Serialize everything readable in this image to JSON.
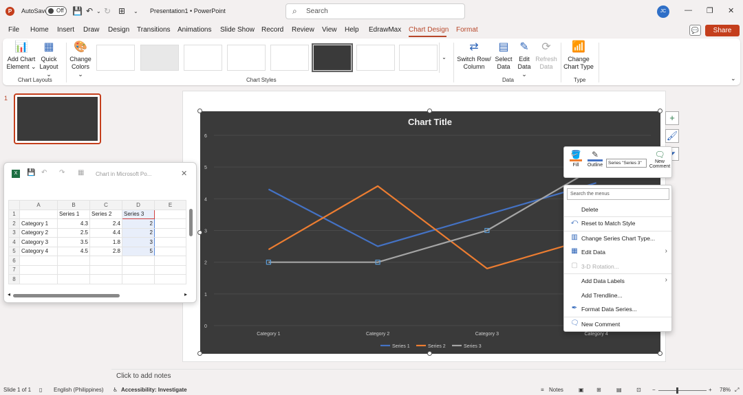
{
  "titlebar": {
    "logo": "P",
    "autosave_label": "AutoSave",
    "autosave_state": "Off",
    "doc_title": "Presentation1 • PowerPoint",
    "search_placeholder": "Search",
    "avatar_initials": "JC"
  },
  "menu": {
    "tabs": [
      "File",
      "Home",
      "Insert",
      "Draw",
      "Design",
      "Transitions",
      "Animations",
      "Slide Show",
      "Record",
      "Review",
      "View",
      "Help",
      "EdrawMax",
      "Chart Design",
      "Format"
    ],
    "active": "Chart Design",
    "share_label": "Share"
  },
  "ribbon": {
    "add_chart_element": [
      "Add Chart",
      "Element"
    ],
    "quick_layout": [
      "Quick",
      "Layout"
    ],
    "change_colors": [
      "Change",
      "Colors"
    ],
    "switch_row_column": [
      "Switch Row/",
      "Column"
    ],
    "select_data": [
      "Select",
      "Data"
    ],
    "edit_data": [
      "Edit",
      "Data"
    ],
    "refresh_data": [
      "Refresh",
      "Data"
    ],
    "change_chart_type": [
      "Change",
      "Chart Type"
    ],
    "groups": {
      "chart_layouts": "Chart Layouts",
      "chart_styles": "Chart Styles",
      "data": "Data",
      "type": "Type"
    }
  },
  "slides_panel": {
    "slide_number": "1"
  },
  "excel": {
    "title": "Chart in Microsoft Po...",
    "columns": [
      "A",
      "B",
      "C",
      "D",
      "E"
    ],
    "rows": [
      [
        "",
        "Series 1",
        "Series 2",
        "Series 3",
        ""
      ],
      [
        "Category 1",
        "4.3",
        "2.4",
        "2",
        ""
      ],
      [
        "Category 2",
        "2.5",
        "4.4",
        "2",
        ""
      ],
      [
        "Category 3",
        "3.5",
        "1.8",
        "3",
        ""
      ],
      [
        "Category 4",
        "4.5",
        "2.8",
        "5",
        ""
      ],
      [
        "",
        "",
        "",
        "",
        ""
      ],
      [
        "",
        "",
        "",
        "",
        ""
      ],
      [
        "",
        "",
        "",
        "",
        ""
      ]
    ],
    "row_numbers": [
      "1",
      "2",
      "3",
      "4",
      "5",
      "6",
      "7",
      "8"
    ]
  },
  "chart_data": {
    "type": "line",
    "title": "Chart Title",
    "categories": [
      "Category 1",
      "Category 2",
      "Category 3",
      "Category 4"
    ],
    "series": [
      {
        "name": "Series 1",
        "values": [
          4.3,
          2.5,
          3.5,
          4.5
        ],
        "color": "#4472c4"
      },
      {
        "name": "Series 2",
        "values": [
          2.4,
          4.4,
          1.8,
          2.8
        ],
        "color": "#ed7d31"
      },
      {
        "name": "Series 3",
        "values": [
          2,
          2,
          3,
          5
        ],
        "color": "#a5a5a5"
      }
    ],
    "ylim": [
      0,
      6
    ],
    "yticks": [
      "0",
      "1",
      "2",
      "3",
      "4",
      "5",
      "6"
    ],
    "legend_position": "bottom",
    "background": "#3a3a3a"
  },
  "mini_toolbar": {
    "fill_label": "Fill",
    "outline_label": "Outline",
    "series_select": "Series \"Series 3\"",
    "new_comment_label": [
      "New",
      "Comment"
    ]
  },
  "context_menu": {
    "search_placeholder": "Search the menus",
    "items": [
      {
        "label": "Delete",
        "icon": "",
        "disabled": false,
        "submenu": false
      },
      {
        "label": "Reset to Match Style",
        "icon": "reset-style-icon",
        "disabled": false,
        "submenu": false
      },
      {
        "label": "Change Series Chart Type...",
        "icon": "chart-type-icon",
        "disabled": false,
        "submenu": false
      },
      {
        "label": "Edit Data",
        "icon": "edit-data-icon",
        "disabled": false,
        "submenu": true
      },
      {
        "label": "3-D Rotation...",
        "icon": "rotation-icon",
        "disabled": true,
        "submenu": false
      },
      {
        "label": "Add Data Labels",
        "icon": "",
        "disabled": false,
        "submenu": true
      },
      {
        "label": "Add Trendline...",
        "icon": "",
        "disabled": false,
        "submenu": false
      },
      {
        "label": "Format Data Series...",
        "icon": "format-icon",
        "disabled": false,
        "submenu": false
      },
      {
        "label": "New Comment",
        "icon": "comment-icon",
        "disabled": false,
        "submenu": false
      }
    ]
  },
  "notes": {
    "placeholder": "Click to add notes"
  },
  "status": {
    "slide_of": "Slide 1 of 1",
    "language": "English (Philippines)",
    "accessibility": "Accessibility: Investigate",
    "notes_label": "Notes",
    "zoom": "78%"
  }
}
